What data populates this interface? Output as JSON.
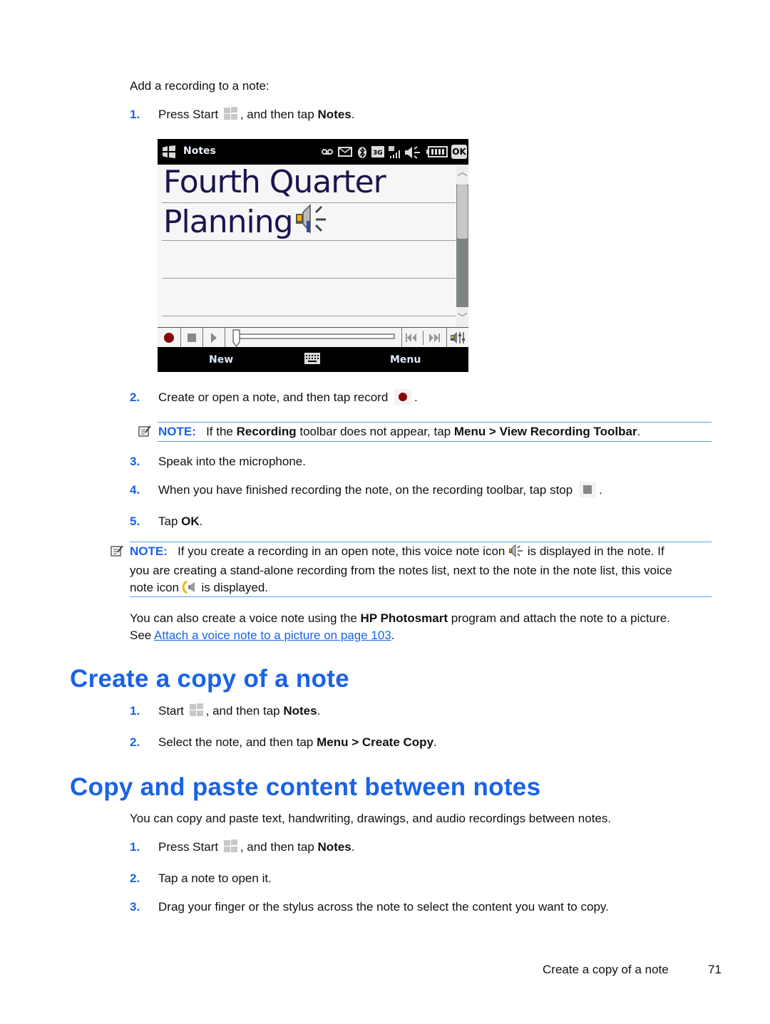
{
  "intro": "Add a recording to a note:",
  "section1_steps": [
    {
      "num": "1.",
      "pre": "Press Start",
      "mid": ", and then tap ",
      "bold": "Notes",
      "post": "."
    },
    {
      "num": "2.",
      "pre": "Create or open a note, and then tap record",
      "post": "."
    },
    {
      "num": "3.",
      "text": "Speak into the microphone."
    },
    {
      "num": "4.",
      "pre": "When you have finished recording the note, on the recording toolbar, tap stop",
      "post": "."
    },
    {
      "num": "5.",
      "pre": "Tap ",
      "bold": "OK",
      "post": "."
    }
  ],
  "device": {
    "app_title": "Notes",
    "status_icons": [
      "voicemail-icon",
      "message-icon",
      "bluetooth-icon",
      "3g-icon",
      "signal-icon",
      "volume-icon",
      "battery-icon"
    ],
    "ok_label": "OK",
    "note_lines": [
      "Fourth Quarter",
      "Planning"
    ],
    "softkey_left": "New",
    "softkey_right": "Menu",
    "colors": {
      "ink": "#1a1550",
      "record": "#8b0000",
      "titlebar": "#000000"
    }
  },
  "note1": {
    "label": "NOTE:",
    "t1": "If the ",
    "b1": "Recording",
    "t2": " toolbar does not appear, tap ",
    "b2": "Menu > View Recording Toolbar",
    "t3": "."
  },
  "note2": {
    "label": "NOTE:",
    "line1_a": "If you create a recording in an open note, this voice note icon",
    "line1_b": "is displayed in the note. If",
    "line2": "you are creating a stand-alone recording from the notes list, next to the note in the note list, this voice",
    "line3_a": "note icon",
    "line3_b": "is displayed."
  },
  "photosmart": {
    "t1": "You can also create a voice note using the ",
    "b1": "HP Photosmart",
    "t2": " program and attach the note to a picture.",
    "see": "See ",
    "link": "Attach a voice note to a picture on page 103",
    "end": "."
  },
  "section2": {
    "heading": "Create a copy of a note",
    "steps": [
      {
        "num": "1.",
        "pre": "Start",
        "mid": ", and then tap ",
        "bold": "Notes",
        "post": "."
      },
      {
        "num": "2.",
        "pre": "Select the note, and then tap ",
        "bold": "Menu > Create Copy",
        "post": "."
      }
    ]
  },
  "section3": {
    "heading": "Copy and paste content between notes",
    "intro": "You can copy and paste text, handwriting, drawings, and audio recordings between notes.",
    "steps": [
      {
        "num": "1.",
        "pre": "Press Start",
        "mid": ", and then tap ",
        "bold": "Notes",
        "post": "."
      },
      {
        "num": "2.",
        "text": "Tap a note to open it."
      },
      {
        "num": "3.",
        "text": "Drag your finger or the stylus across the note to select the content you want to copy."
      }
    ]
  },
  "footer": {
    "section": "Create a copy of a note",
    "page": "71"
  },
  "colors": {
    "accent": "#1a62e8",
    "rule": "#5b9bf0"
  }
}
